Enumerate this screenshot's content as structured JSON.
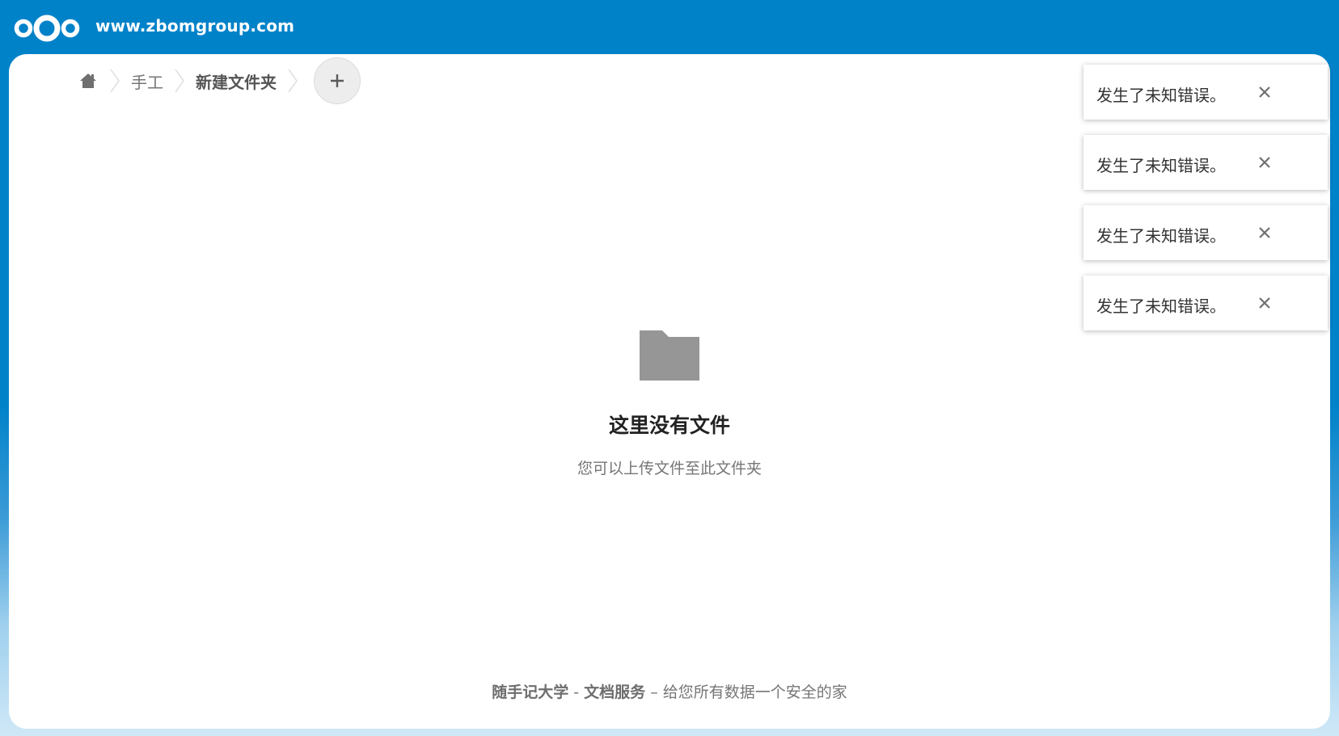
{
  "header": {
    "site_title": "www.zbomgroup.com",
    "logo_icon": "nextcloud-logo-icon",
    "brand_color": "#0082c9"
  },
  "breadcrumb": {
    "home_icon": "home-icon",
    "items": [
      {
        "label": "手工"
      },
      {
        "label": "新建文件夹"
      }
    ],
    "add_icon": "plus-icon"
  },
  "empty_state": {
    "icon": "folder-icon",
    "title": "这里没有文件",
    "subtitle": "您可以上传文件至此文件夹"
  },
  "footer": {
    "org": "随手记大学",
    "separator": " - ",
    "service": "文档服务",
    "tagline": " – 给您所有数据一个安全的家"
  },
  "toasts": [
    {
      "message": "发生了未知错误。"
    },
    {
      "message": "发生了未知错误。"
    },
    {
      "message": "发生了未知错误。"
    },
    {
      "message": "发生了未知错误。"
    }
  ]
}
